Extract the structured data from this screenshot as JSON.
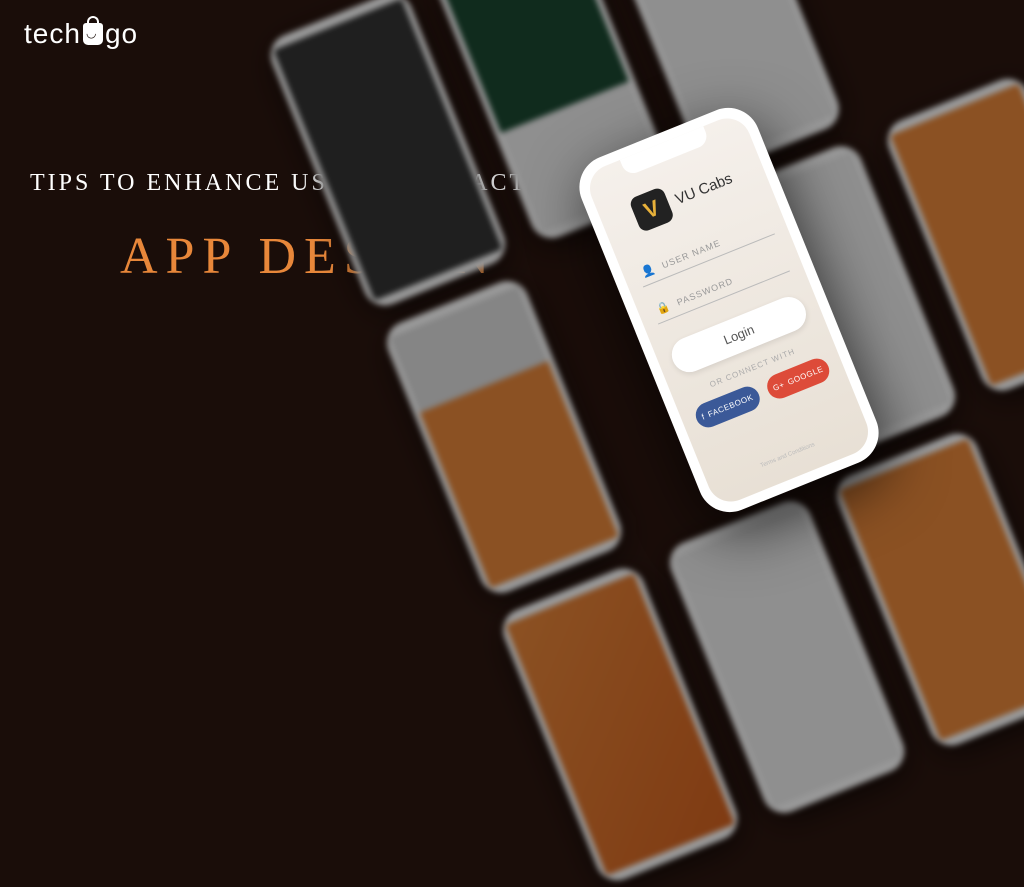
{
  "brand": "techugo",
  "subtitle": "TIPS TO ENHANCE USER- INTERACTION WITH",
  "title": "APP DESIGN",
  "hero": {
    "app_name": "VU Cabs",
    "app_logo_letter": "V",
    "username_label": "USER NAME",
    "password_label": "PASSWORD",
    "login_label": "Login",
    "connect_label": "OR CONNECT WITH",
    "facebook_label": "FACEBOOK",
    "google_label": "GOOGLE",
    "terms": "Terms and Conditions"
  }
}
